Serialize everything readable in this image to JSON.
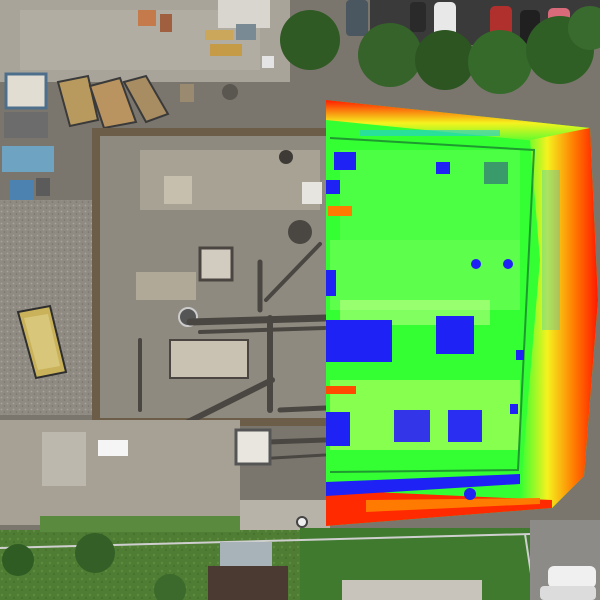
{
  "view": {
    "kind": "aerial-orthophoto-with-elevation-overlay",
    "overlay_scale_colors": [
      "#1e22f5",
      "#33ff33",
      "#f5f21e",
      "#ff2a00"
    ],
    "ground_colors": {
      "soil": "#8a8478",
      "gravel": "#9a968f",
      "concrete": "#b6b1a6",
      "grass": "#4f7d34",
      "trees": "#2f5a24"
    }
  }
}
